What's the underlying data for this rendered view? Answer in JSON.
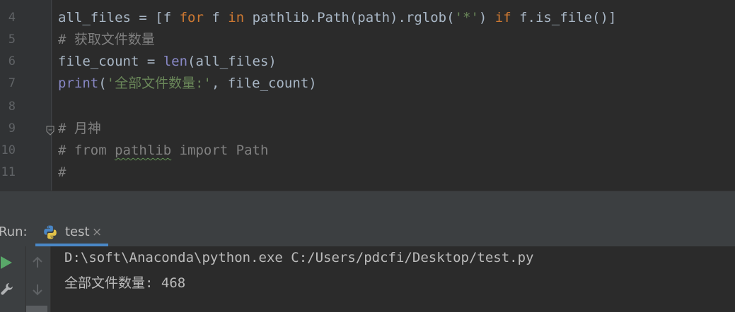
{
  "editor": {
    "line_numbers": [
      "4",
      "5",
      "6",
      "7",
      "8",
      "9",
      "10",
      "11"
    ],
    "line4": {
      "p1": "all_files = [f ",
      "kw_for": "for",
      "p2": " f ",
      "kw_in": "in",
      "p3": " pathlib.Path(path).rglob(",
      "str": "'*'",
      "p4": ") ",
      "kw_if": "if",
      "p5": " f.is_file()]"
    },
    "line5": "# 获取文件数量",
    "line6": {
      "p1": "file_count = ",
      "bi_len": "len",
      "p2": "(all_files)"
    },
    "line7": {
      "bi_print": "print",
      "p1": "(",
      "str": "'全部文件数量:'",
      "p2": ", file_count)"
    },
    "line9": "# 月神",
    "line10": {
      "p1": "# from ",
      "typo": "pathlib",
      "p2": " import Path"
    },
    "line11": "#"
  },
  "run_panel": {
    "label": "Run:",
    "tab_label": "test",
    "close_glyph": "×",
    "console_lines": [
      "D:\\soft\\Anaconda\\python.exe C:/Users/pdcfi/Desktop/test.py",
      "全部文件数量: 468"
    ]
  },
  "icons": [
    "python-icon",
    "run-icon",
    "wrench-icon",
    "arrow-up-icon",
    "arrow-down-icon",
    "fold-icon"
  ],
  "colors": {
    "background": "#2b2b2b",
    "keyword": "#cc7832",
    "builtin": "#8888c6",
    "string": "#6a8759",
    "comment": "#808080",
    "tab_underline": "#4a88c7",
    "run_green": "#59a869"
  }
}
